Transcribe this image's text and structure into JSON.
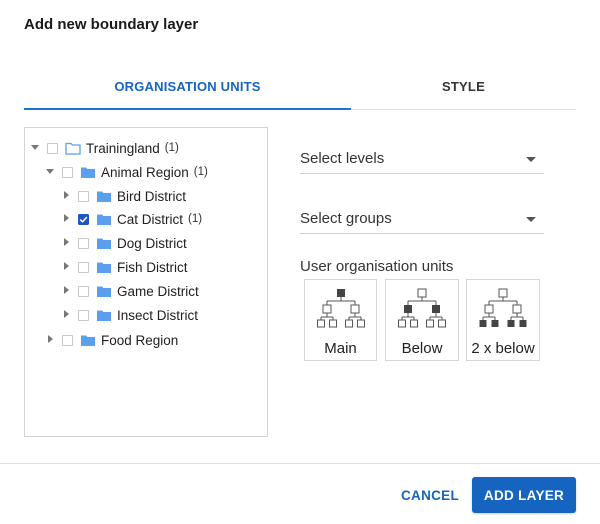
{
  "dialog": {
    "title": "Add new boundary layer"
  },
  "tabs": [
    {
      "label": "ORGANISATION UNITS",
      "active": true
    },
    {
      "label": "STYLE",
      "active": false
    }
  ],
  "tree": {
    "nodes": [
      {
        "label": "Trainingland",
        "count": "(1)",
        "expanded": true,
        "checked": false
      },
      {
        "label": "Animal Region",
        "count": "(1)",
        "expanded": true,
        "checked": false
      },
      {
        "label": "Bird District",
        "count": "",
        "expanded": false,
        "checked": false
      },
      {
        "label": "Cat District",
        "count": "(1)",
        "expanded": false,
        "checked": true
      },
      {
        "label": "Dog District",
        "count": "",
        "expanded": false,
        "checked": false
      },
      {
        "label": "Fish District",
        "count": "",
        "expanded": false,
        "checked": false
      },
      {
        "label": "Game District",
        "count": "",
        "expanded": false,
        "checked": false
      },
      {
        "label": "Insect District",
        "count": "",
        "expanded": false,
        "checked": false
      },
      {
        "label": "Food Region",
        "count": "",
        "expanded": false,
        "checked": false
      }
    ]
  },
  "levels_select": {
    "label": "Select levels"
  },
  "groups_select": {
    "label": "Select groups"
  },
  "user_org_units": {
    "label": "User organisation units",
    "options": [
      {
        "label": "Main"
      },
      {
        "label": "Below"
      },
      {
        "label": "2 x below"
      }
    ]
  },
  "footer": {
    "cancel_label": "CANCEL",
    "add_label": "ADD LAYER"
  },
  "colors": {
    "accent": "#1565c0",
    "folder": "#5b9ff0",
    "checkbox_checked": "#1a56c5"
  },
  "icons": {
    "folder_open": "folder-outline-icon",
    "folder": "folder-icon",
    "checkbox": "checkbox-icon",
    "caret": "caret-down-icon",
    "expand": "expand-arrow-icon"
  }
}
